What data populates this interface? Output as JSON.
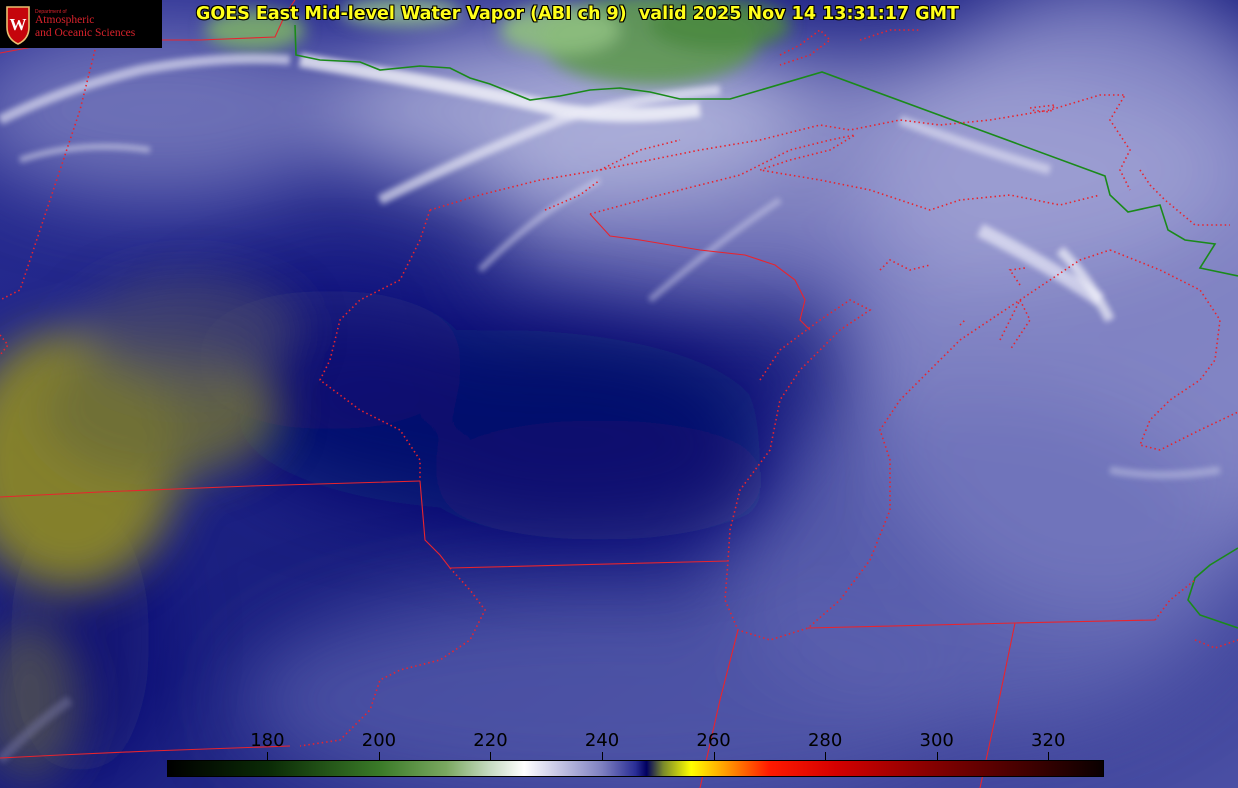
{
  "title": "GOES East Mid-level Water Vapor (ABI ch 9)  valid 2025 Nov 14 13:31:17 GMT",
  "logo": {
    "department": "Department of",
    "line1": "Atmospheric",
    "line2": "and Oceanic Sciences",
    "seal_letter": "W"
  },
  "colorbar": {
    "min": 162,
    "max": 330,
    "ticks": [
      "180",
      "200",
      "220",
      "240",
      "260",
      "280",
      "300",
      "320"
    ],
    "stops": [
      {
        "value": 162,
        "color": "#000000"
      },
      {
        "value": 180,
        "color": "#0a2a06"
      },
      {
        "value": 200,
        "color": "#3a7a28"
      },
      {
        "value": 212,
        "color": "#7aa860"
      },
      {
        "value": 220,
        "color": "#c8dcc4"
      },
      {
        "value": 226,
        "color": "#ffffff"
      },
      {
        "value": 232,
        "color": "#c8c8e6"
      },
      {
        "value": 240,
        "color": "#7e80c0"
      },
      {
        "value": 246,
        "color": "#2a2e96"
      },
      {
        "value": 248,
        "color": "#000060"
      },
      {
        "value": 251,
        "color": "#7a8a2a"
      },
      {
        "value": 256,
        "color": "#ffff00"
      },
      {
        "value": 262,
        "color": "#ffa000"
      },
      {
        "value": 270,
        "color": "#ff1a00"
      },
      {
        "value": 282,
        "color": "#d40000"
      },
      {
        "value": 300,
        "color": "#820000"
      },
      {
        "value": 330,
        "color": "#0a0000"
      }
    ]
  },
  "colors": {
    "title_text": "#ffff1a",
    "state_border": "#e8242e",
    "intl_border": "#1a8a1a",
    "moist_white": "#ffffff",
    "dry_blue": "#0a1280",
    "very_dry_olive": "#7a7a1e"
  }
}
